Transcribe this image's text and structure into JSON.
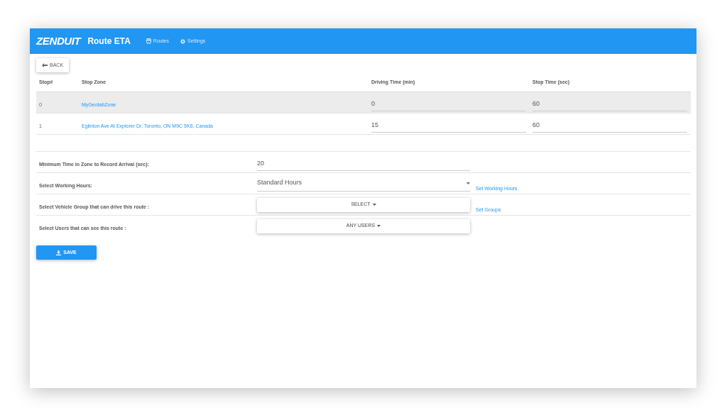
{
  "header": {
    "logo": "ZENDUIT",
    "title": "Route ETA",
    "nav": [
      {
        "label": "Routes"
      },
      {
        "label": "Settings"
      }
    ]
  },
  "back_button": "BACK",
  "table": {
    "columns": [
      "Stop#",
      "Stop Zone",
      "Driving Time (min)",
      "Stop Time (sec)"
    ],
    "rows": [
      {
        "stop": "0",
        "zone": "MyGeotabZone",
        "driving_time": "0",
        "stop_time": "60",
        "selected": true
      },
      {
        "stop": "1",
        "zone": "Eglinton Ave At Explorer Dr, Toronto, ON M9C 5K6, Canada",
        "driving_time": "15",
        "stop_time": "60",
        "selected": false
      }
    ]
  },
  "form": [
    {
      "kind": "input",
      "label": "Minimum Time in Zone to Record Arrival (sec):",
      "value": "20"
    },
    {
      "kind": "dropdown",
      "label": "Select Working Hours:",
      "value": "Standard Hours",
      "link": "Set Working Hours"
    },
    {
      "kind": "button",
      "label": "Select Vehicle Group that can drive this route :",
      "value": "SELECT",
      "link": "Set Groups"
    },
    {
      "kind": "button",
      "label": "Select Users that can see this route :",
      "value": "ANY USERS"
    }
  ],
  "save_button": "SAVE"
}
